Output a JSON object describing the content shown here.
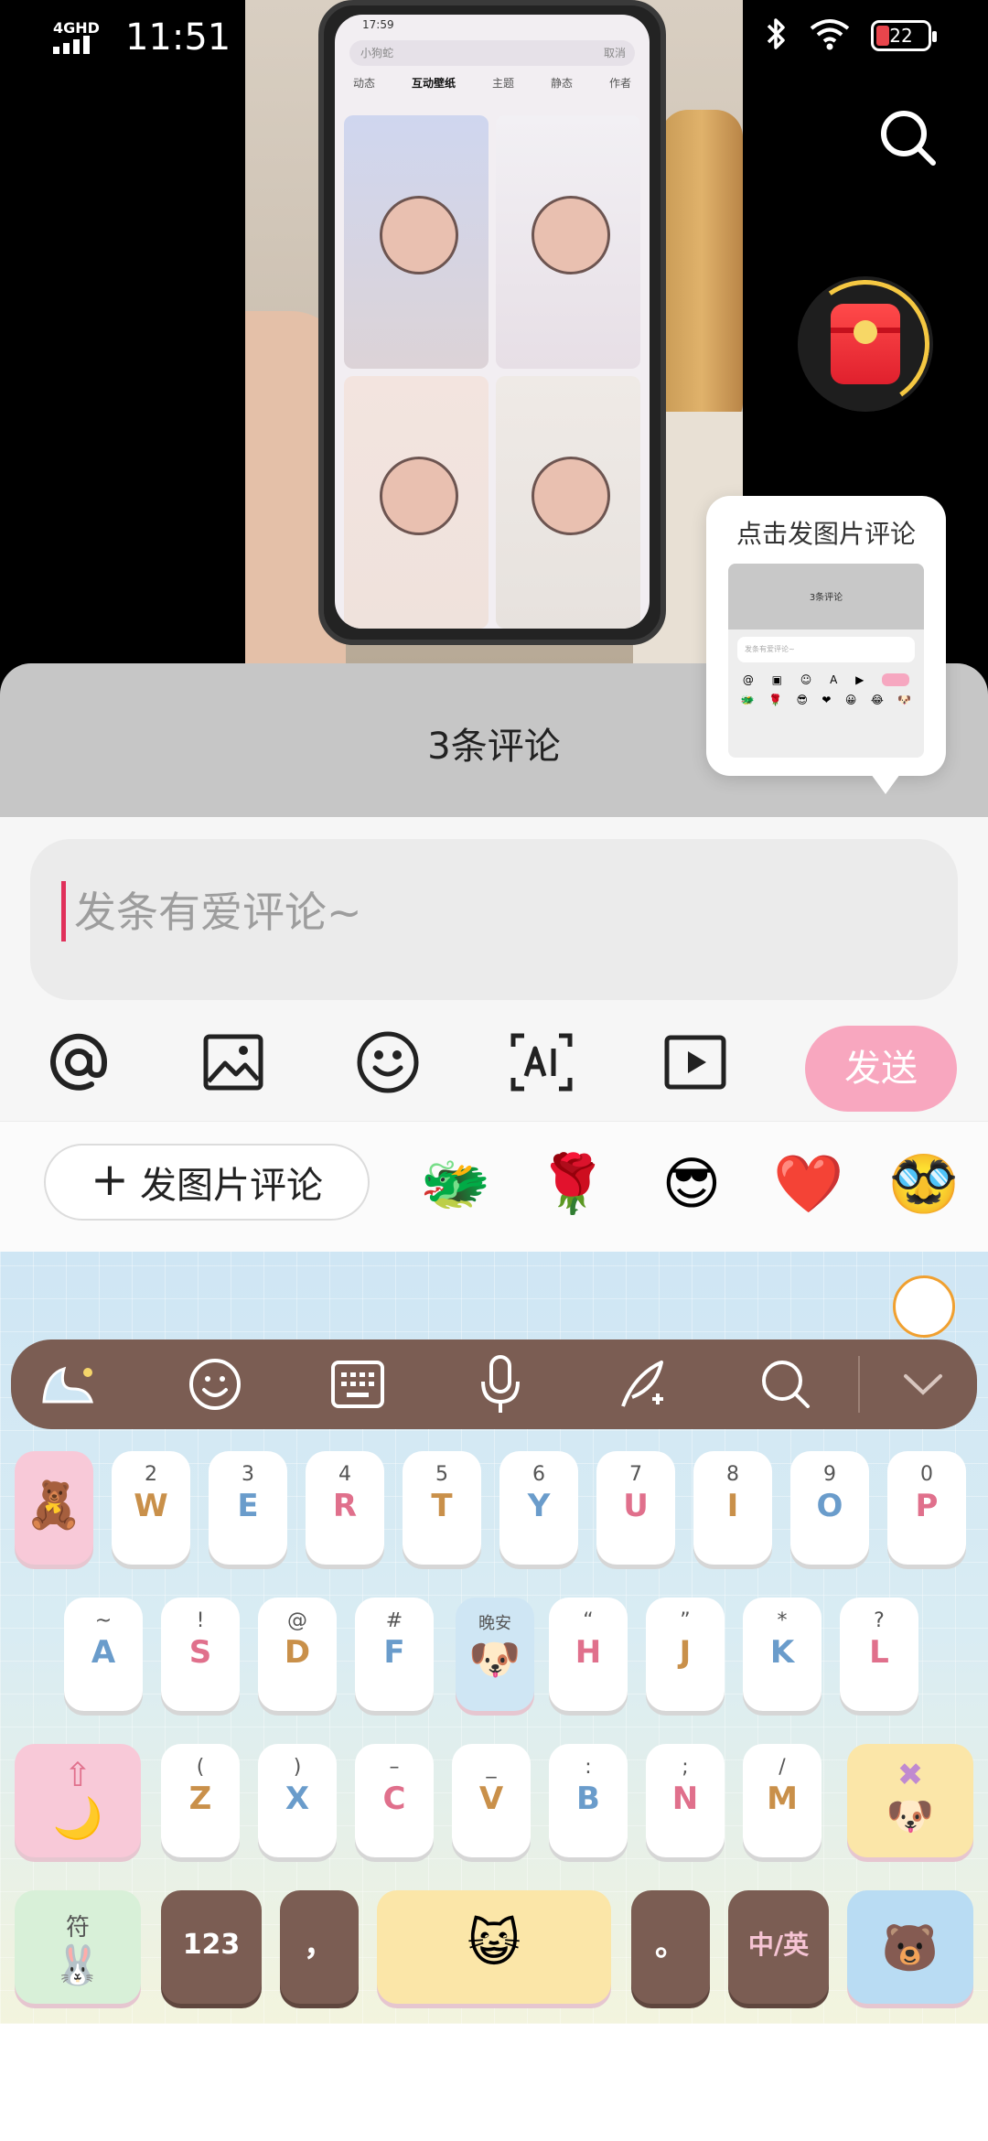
{
  "status_bar": {
    "network": "4GHD",
    "time": "11:51",
    "battery": "22"
  },
  "video": {
    "phone_status_time": "17:59",
    "phone_search": "小狗蛇",
    "phone_cancel": "取消",
    "phone_tabs": [
      "动态",
      "互动壁纸",
      "主题",
      "静态",
      "作者"
    ],
    "phone_active_tab": "互动壁纸"
  },
  "tooltip": {
    "text": "点击发图片评论",
    "thumb_title": "3条评论",
    "thumb_input": "发条有爱评论~"
  },
  "comments": {
    "title": "3条评论",
    "input_placeholder": "发条有爱评论~",
    "send_label": "发送",
    "image_comment_label": "发图片评论",
    "quick_emojis": [
      "🐲",
      "🌹",
      "😎",
      "❤️",
      "🥸"
    ]
  },
  "keyboard": {
    "row1": [
      {
        "sub": "2",
        "main": "W",
        "color": "tan"
      },
      {
        "sub": "3",
        "main": "E",
        "color": "blue"
      },
      {
        "sub": "4",
        "main": "R",
        "color": "pink"
      },
      {
        "sub": "5",
        "main": "T",
        "color": "tan"
      },
      {
        "sub": "6",
        "main": "Y",
        "color": "blue"
      },
      {
        "sub": "7",
        "main": "U",
        "color": "pink"
      },
      {
        "sub": "8",
        "main": "I",
        "color": "tan"
      },
      {
        "sub": "9",
        "main": "O",
        "color": "blue"
      },
      {
        "sub": "0",
        "main": "P",
        "color": "pink"
      }
    ],
    "row2": [
      {
        "sub": "~",
        "main": "A",
        "color": "blue"
      },
      {
        "sub": "!",
        "main": "S",
        "color": "pink"
      },
      {
        "sub": "@",
        "main": "D",
        "color": "tan"
      },
      {
        "sub": "#",
        "main": "F",
        "color": "blue"
      },
      {
        "sub": "“",
        "main": "H",
        "color": "pink"
      },
      {
        "sub": "”",
        "main": "J",
        "color": "tan"
      },
      {
        "sub": "*",
        "main": "K",
        "color": "blue"
      },
      {
        "sub": "?",
        "main": "L",
        "color": "pink"
      }
    ],
    "row3": [
      {
        "sub": "(",
        "main": "Z",
        "color": "tan"
      },
      {
        "sub": ")",
        "main": "X",
        "color": "blue"
      },
      {
        "sub": "–",
        "main": "C",
        "color": "pink"
      },
      {
        "sub": "_",
        "main": "V",
        "color": "tan"
      },
      {
        "sub": ":",
        "main": "B",
        "color": "blue"
      },
      {
        "sub": ";",
        "main": "N",
        "color": "pink"
      },
      {
        "sub": "/",
        "main": "M",
        "color": "tan"
      }
    ],
    "symbol_key_label": "符",
    "numbers_key": "123",
    "comma_key": "，",
    "period_key": "。",
    "lang_key": "中/英",
    "sticker_label": "晚安"
  },
  "colors": {
    "accent_pink": "#f8a7bf",
    "keyboard_toolbar": "#7b5d53",
    "tan": "#c9904a",
    "pink": "#e0708c",
    "blue": "#6a9ccb"
  }
}
